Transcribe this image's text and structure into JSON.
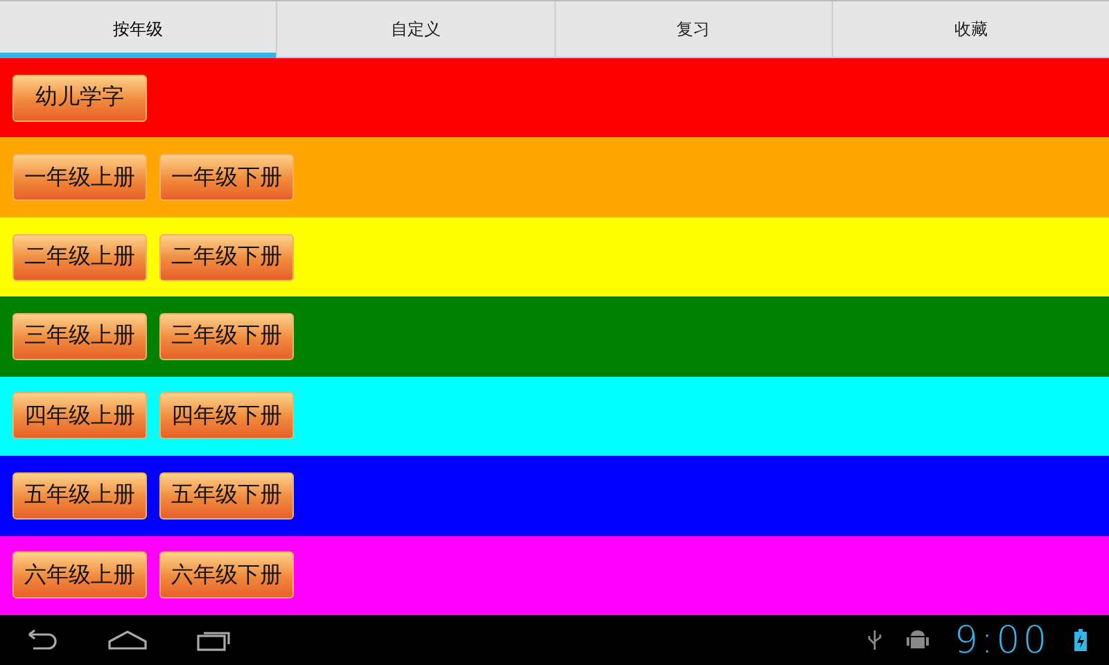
{
  "tabs": [
    {
      "label": "按年级",
      "selected": true
    },
    {
      "label": "自定义",
      "selected": false
    },
    {
      "label": "复习",
      "selected": false
    },
    {
      "label": "收藏",
      "selected": false
    }
  ],
  "grades": [
    {
      "color": "#ff0000",
      "buttons": [
        "幼儿学字"
      ]
    },
    {
      "color": "#ffa500",
      "buttons": [
        "一年级上册",
        "一年级下册"
      ]
    },
    {
      "color": "#ffff00",
      "buttons": [
        "二年级上册",
        "二年级下册"
      ]
    },
    {
      "color": "#008000",
      "buttons": [
        "三年级上册",
        "三年级下册"
      ]
    },
    {
      "color": "#00ffff",
      "buttons": [
        "四年级上册",
        "四年级下册"
      ]
    },
    {
      "color": "#0000ff",
      "buttons": [
        "五年级上册",
        "五年级下册"
      ]
    },
    {
      "color": "#ff00ff",
      "buttons": [
        "六年级上册",
        "六年级下册"
      ]
    }
  ],
  "status_bar": {
    "time": "9:00"
  }
}
